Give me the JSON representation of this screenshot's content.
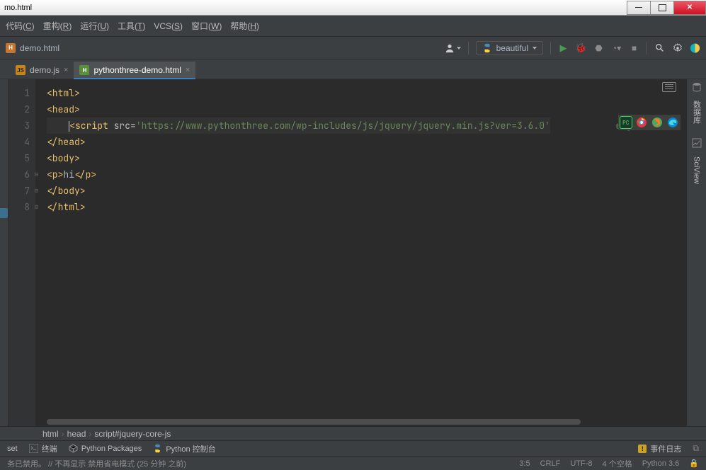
{
  "window": {
    "title": "mo.html"
  },
  "menu": {
    "code": "代码(C)",
    "refactor": "重构(R)",
    "run": "运行(U)",
    "tools": "工具(T)",
    "vcs": "VCS(S)",
    "window": "窗口(W)",
    "help": "帮助(H)"
  },
  "nav": {
    "path_file": "demo.html",
    "run_config": "beautiful"
  },
  "tabs": [
    {
      "label": "demo.js",
      "icon": "js",
      "active": false
    },
    {
      "label": "pythonthree-demo.html",
      "icon": "html",
      "active": true
    }
  ],
  "editor": {
    "lines": [
      1,
      2,
      3,
      4,
      5,
      6,
      7,
      8
    ],
    "line1": "<html>",
    "line2": "<head>",
    "line3_tag": "<script",
    "line3_attr": " src=",
    "line3_str": "'https://www.pythonthree.com/wp-includes/js/jquery/jquery.min.js?ver=3.6.0'",
    "line3_tail_str": "e-js'",
    "line3_tail_tag": "><",
    "line4": "</head>",
    "line5": "<body>",
    "line6_open": "<p>",
    "line6_txt": "hi",
    "line6_close": "</p>",
    "line7": "</body>",
    "line8": "</html>"
  },
  "breadcrumb": {
    "a": "html",
    "b": "head",
    "c": "script#jquery-core-js"
  },
  "bottom_tools": {
    "set": "set",
    "terminal": "终端",
    "packages": "Python Packages",
    "console": "Python 控制台",
    "events": "事件日志"
  },
  "right_tools": {
    "db": "数据库",
    "sci": "SciView"
  },
  "status": {
    "left": "务已禁用。  // 不再显示   禁用省电模式 (25 分钟 之前)",
    "pos": "3:5",
    "eol": "CRLF",
    "enc": "UTF-8",
    "indent": "4 个空格",
    "py": "Python 3.6"
  }
}
